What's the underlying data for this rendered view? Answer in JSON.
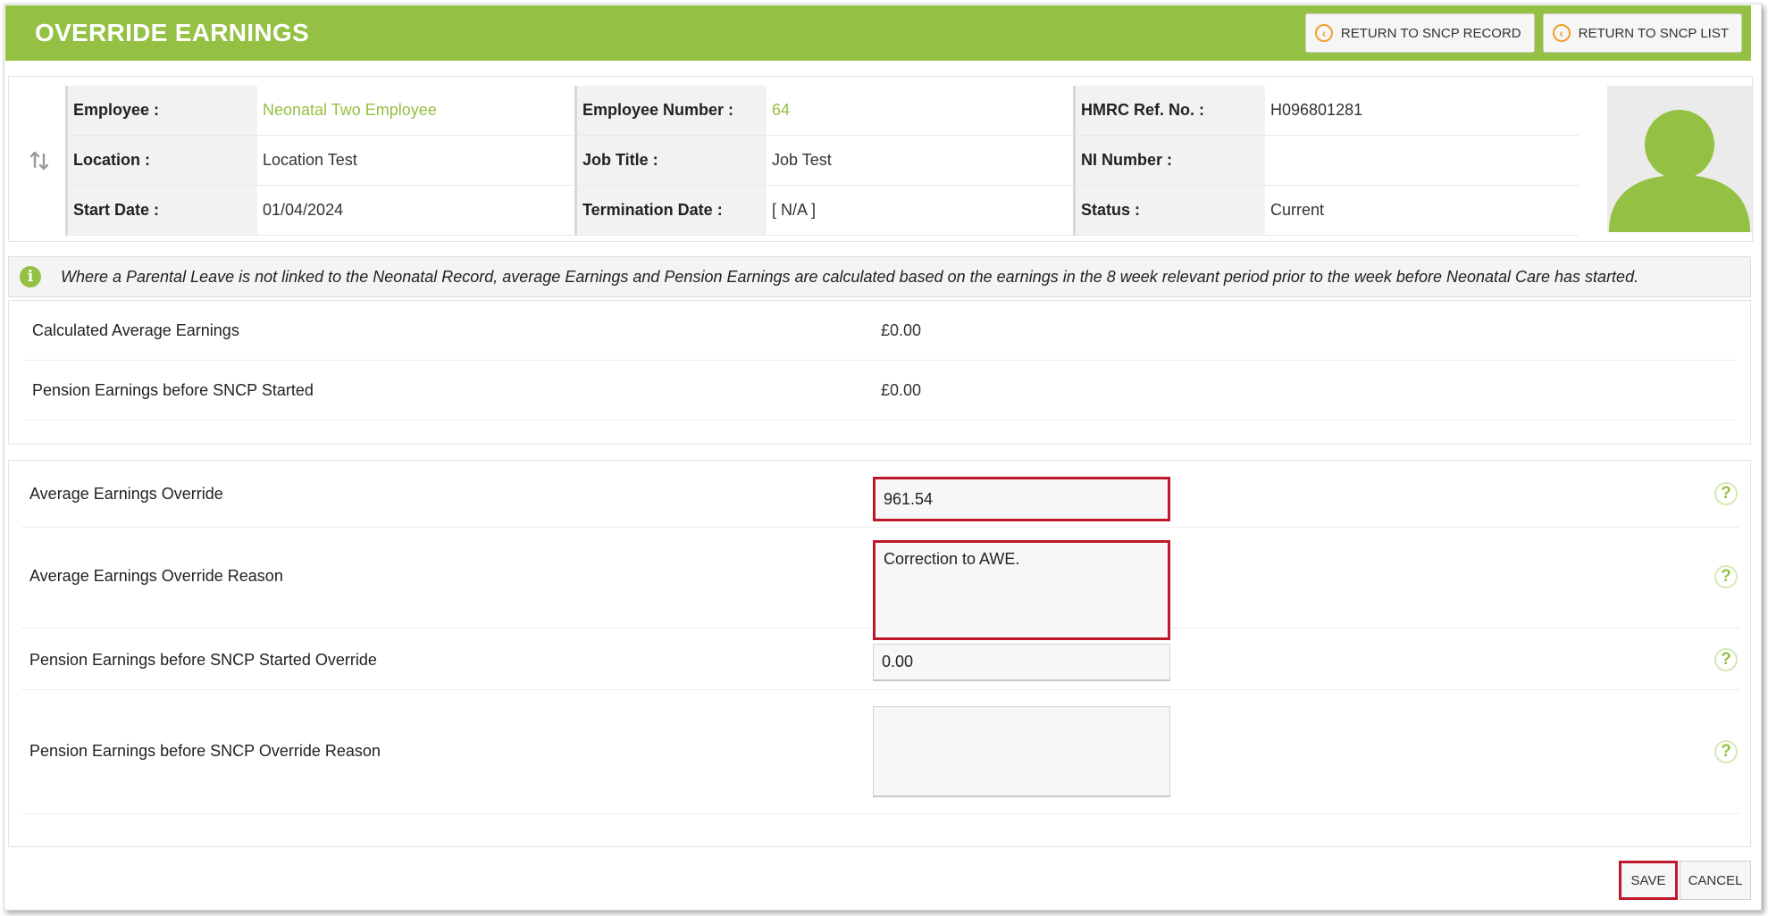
{
  "header": {
    "title": "OVERRIDE EARNINGS",
    "return_record_label": "RETURN TO SNCP RECORD",
    "return_list_label": "RETURN TO SNCP LIST",
    "accent_color": "#94c043"
  },
  "employee": {
    "rows": [
      [
        {
          "label": "Employee :",
          "value": "Neonatal Two Employee"
        },
        {
          "label": "Employee Number :",
          "value": "64"
        },
        {
          "label": "HMRC Ref. No. :",
          "value": "H096801281"
        }
      ],
      [
        {
          "label": "Location :",
          "value": "Location Test"
        },
        {
          "label": "Job Title :",
          "value": "Job Test"
        },
        {
          "label": "NI Number :",
          "value": ""
        }
      ],
      [
        {
          "label": "Start Date :",
          "value": "01/04/2024"
        },
        {
          "label": "Termination Date :",
          "value": "[ N/A ]"
        },
        {
          "label": "Status :",
          "value": "Current"
        }
      ]
    ]
  },
  "info": {
    "icon": "info-icon",
    "text": "Where a Parental Leave is not linked to the Neonatal Record, average Earnings and Pension Earnings are calculated based on the earnings in the 8 week relevant period prior to the week before Neonatal Care has started."
  },
  "calculated": {
    "rows": [
      {
        "label": "Calculated Average Earnings",
        "value": "£0.00"
      },
      {
        "label": "Pension Earnings before SNCP Started",
        "value": "£0.00"
      }
    ]
  },
  "overrides": {
    "rows": [
      {
        "label": "Average Earnings Override",
        "value": "961.54"
      },
      {
        "label": "Average Earnings Override Reason",
        "value": "Correction to AWE."
      },
      {
        "label": "Pension Earnings before SNCP Started Override",
        "value": "0.00"
      },
      {
        "label": "Pension Earnings before SNCP Override Reason",
        "value": ""
      }
    ],
    "help_glyph": "?"
  },
  "footer": {
    "save_label": "SAVE",
    "cancel_label": "CANCEL",
    "highlight_color": "#c0182b"
  }
}
